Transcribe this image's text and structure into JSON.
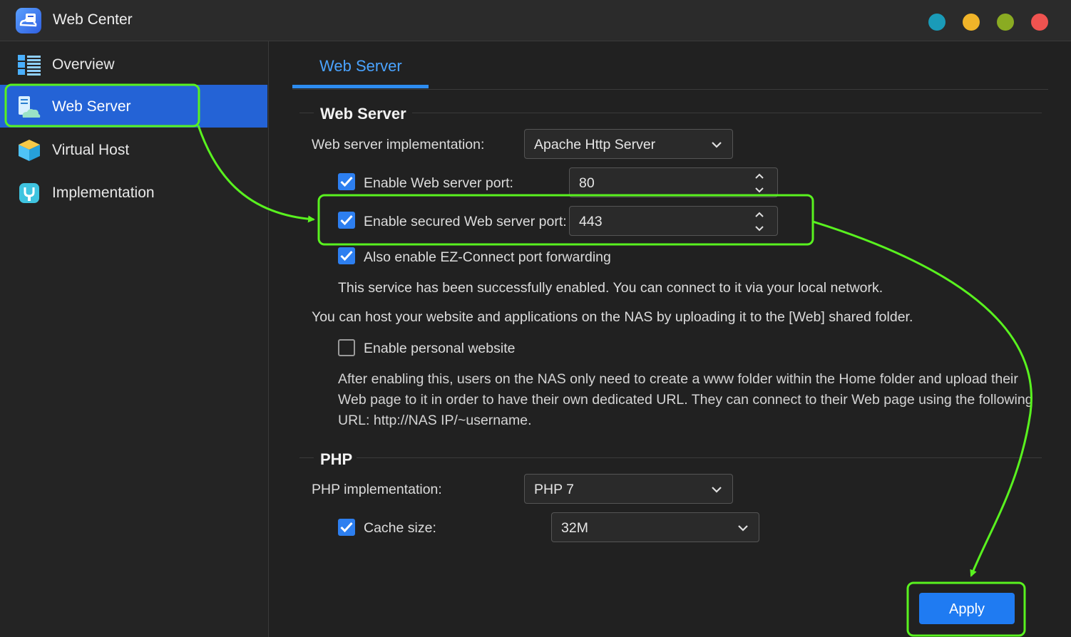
{
  "window": {
    "title": "Web Center",
    "window_controls": [
      {
        "name": "teal-dot",
        "color": "#1a9bb8"
      },
      {
        "name": "yellow-dot",
        "color": "#f0b429"
      },
      {
        "name": "green-dot",
        "color": "#8aab22"
      },
      {
        "name": "red-dot",
        "color": "#ef5350"
      }
    ]
  },
  "sidebar": {
    "items": [
      {
        "label": "Overview",
        "icon": "overview-icon",
        "active": false
      },
      {
        "label": "Web Server",
        "icon": "web-server-icon",
        "active": true
      },
      {
        "label": "Virtual Host",
        "icon": "virtual-host-icon",
        "active": false
      },
      {
        "label": "Implementation",
        "icon": "implementation-icon",
        "active": false
      }
    ]
  },
  "main": {
    "tab_label": "Web Server",
    "web_server": {
      "title": "Web Server",
      "implementation_label": "Web server implementation:",
      "implementation_value": "Apache Http Server",
      "port_label": "Enable Web server port:",
      "port_checked": true,
      "port_value": "80",
      "secure_port_label": "Enable secured Web server port:",
      "secure_port_checked": true,
      "secure_port_value": "443",
      "ezconnect_label": "Also enable EZ-Connect port forwarding",
      "ezconnect_checked": true,
      "status_text": "This service has been successfully enabled. You can connect to it via your local network.",
      "host_info": "You can host your website and applications on the NAS by uploading it to the [Web] shared folder.",
      "personal_label": "Enable personal website",
      "personal_checked": false,
      "personal_desc": "After enabling this, users on the NAS only need to create a www folder within the Home folder and upload their Web page to it in order to have their own dedicated URL. They can connect to their Web page using the following URL: http://NAS IP/~username."
    },
    "php": {
      "title": "PHP",
      "implementation_label": "PHP implementation:",
      "implementation_value": "PHP 7",
      "cache_label": "Cache size:",
      "cache_checked": true,
      "cache_value": "32M"
    },
    "apply_label": "Apply"
  },
  "annotation_color": "#59f21f"
}
